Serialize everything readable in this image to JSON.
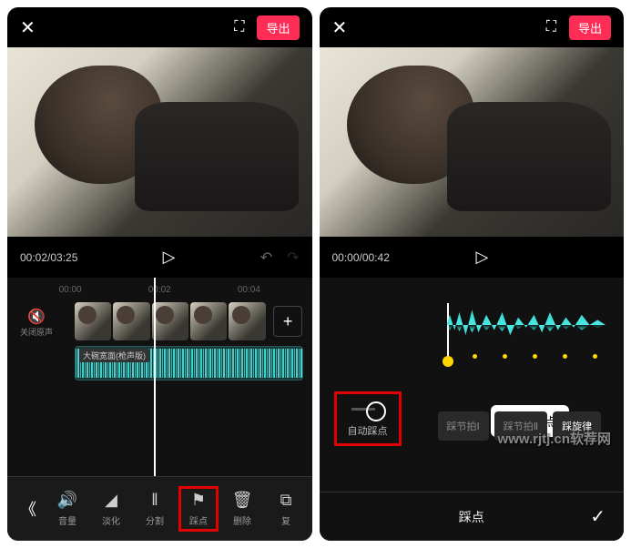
{
  "left": {
    "export_label": "导出",
    "time": "00:02/03:25",
    "ruler": [
      "00:00",
      "00:02",
      "00:04"
    ],
    "mute_label": "关闭原声",
    "audio_label": "大碗宽面(枪声版)",
    "add_clip": "+",
    "tools": [
      {
        "icon": "🔊",
        "label": "音量"
      },
      {
        "icon": "◢",
        "label": "淡化"
      },
      {
        "icon": "‖",
        "label": "分割"
      },
      {
        "icon": "⚑",
        "label": "踩点"
      },
      {
        "icon": "🗑",
        "label": "删除"
      },
      {
        "icon": "⧉",
        "label": "复"
      }
    ]
  },
  "right": {
    "export_label": "导出",
    "time": "00:00/00:42",
    "delete_label": "删除点",
    "auto_label": "自动踩点",
    "beats": [
      "踩节拍Ⅰ",
      "踩节拍Ⅱ",
      "踩旋律"
    ],
    "title": "踩点"
  },
  "watermark": "www.rjtj.cn软荐网"
}
